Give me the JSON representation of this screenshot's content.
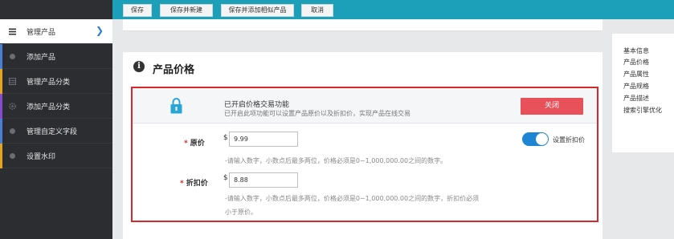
{
  "toolbar": {
    "save": "保存",
    "save_new": "保存并新建",
    "save_add_similar": "保存并添加相似产品",
    "cancel": "取消"
  },
  "sidebar": {
    "items": [
      {
        "label": "管理产品",
        "icon": "list-icon",
        "strip": "#4a7fd8",
        "active": true
      },
      {
        "label": "添加产品",
        "icon": "dot-icon",
        "strip": "#4a7fd8"
      },
      {
        "label": "管理产品分类",
        "icon": "grid-icon",
        "strip": "#e8a31c"
      },
      {
        "label": "添加产品分类",
        "icon": "gear-icon",
        "strip": "#8a4ad0"
      },
      {
        "label": "管理自定义字段",
        "icon": "dot-icon",
        "strip": "#4a7fd8"
      },
      {
        "label": "设置水印",
        "icon": "dot-icon",
        "strip": "#e8a31c"
      }
    ]
  },
  "section": {
    "title": "产品价格",
    "icon": "info-icon"
  },
  "notice": {
    "title": "已开启价格交易功能",
    "desc": "已开启此项功能可以设置产品原价以及折扣价，实现产品在线交易",
    "close": "关闭",
    "icon": "lock-icon"
  },
  "price": {
    "required": "*",
    "original_label": "原价",
    "currency": "$",
    "original_value": "9.99",
    "original_hint": "-请输入数字，小数点后最多两位，价格必须是0~1,000,000.00之间的数字。",
    "discount_label": "折扣价",
    "discount_value": "8.88",
    "discount_hint_1": "-请输入数字，小数点后最多两位，价格必须是0~1,000,000.00之间的数字，折扣价必须",
    "discount_hint_2": "小于原价。",
    "toggle_label": "设置折扣价",
    "toggle_on": true
  },
  "right_nav": {
    "items": [
      "基本信息",
      "产品价格",
      "产品属性",
      "产品规格",
      "产品描述",
      "搜索引擎优化"
    ]
  },
  "colors": {
    "topbar": "#1ca0b9",
    "sidebar": "#2c2d31",
    "highlight": "#d9272e",
    "close_button": "#e8515a",
    "toggle": "#1e84d4"
  }
}
